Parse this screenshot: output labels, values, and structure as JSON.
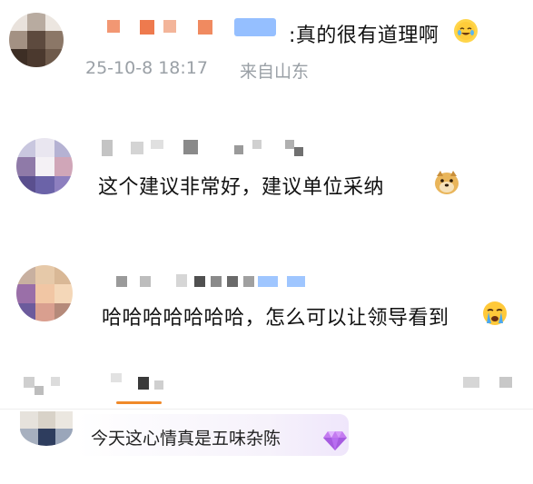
{
  "comments": [
    {
      "text": ":真的很有道理啊",
      "emoji_name": "crying-laughing-emoji",
      "timestamp": "25-10-8 18:17",
      "location": "来自山东"
    },
    {
      "text": "这个建议非常好，建议单位采纳",
      "emoji_name": "doge-emoji"
    },
    {
      "text": "哈哈哈哈哈哈哈，怎么可以让领导看到",
      "emoji_name": "crying-emoji"
    }
  ],
  "bottom_card": {
    "status_text": "今天这心情真是五味杂陈",
    "badge_icon": "diamond-icon"
  },
  "colors": {
    "accent": "#f08a2a",
    "username_blue": "#8ab8ff",
    "username_orange": "#f0855a",
    "meta_gray": "#9aa0a6"
  }
}
